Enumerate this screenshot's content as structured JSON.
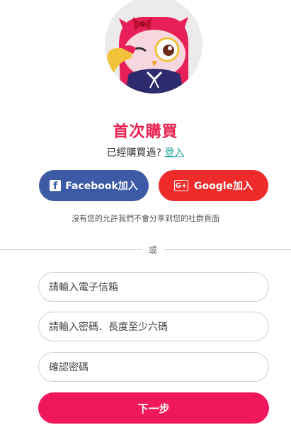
{
  "header": {
    "title": "首次購買",
    "login_prompt": "已經購買過?",
    "login_link": "登入"
  },
  "social": {
    "facebook_label": "Facebook加入",
    "google_label": "Google加入",
    "privacy_note": "沒有您的允許我們不會分享到您的社群頁面"
  },
  "divider": {
    "text": "或"
  },
  "form": {
    "email_placeholder": "請輸入電子信箱",
    "password_placeholder": "請輸入密碼．長度至少六碼",
    "confirm_placeholder": "確認密碼",
    "next_label": "下一步"
  },
  "icons": {
    "facebook": "facebook-icon",
    "google": "google-plus-icon",
    "mascot": "owl-mascot"
  },
  "colors": {
    "title": "#e8204f",
    "link": "#1aa39a",
    "facebook": "#3c5aa5",
    "google": "#ee2a2a",
    "next_button": "#f0185c"
  }
}
